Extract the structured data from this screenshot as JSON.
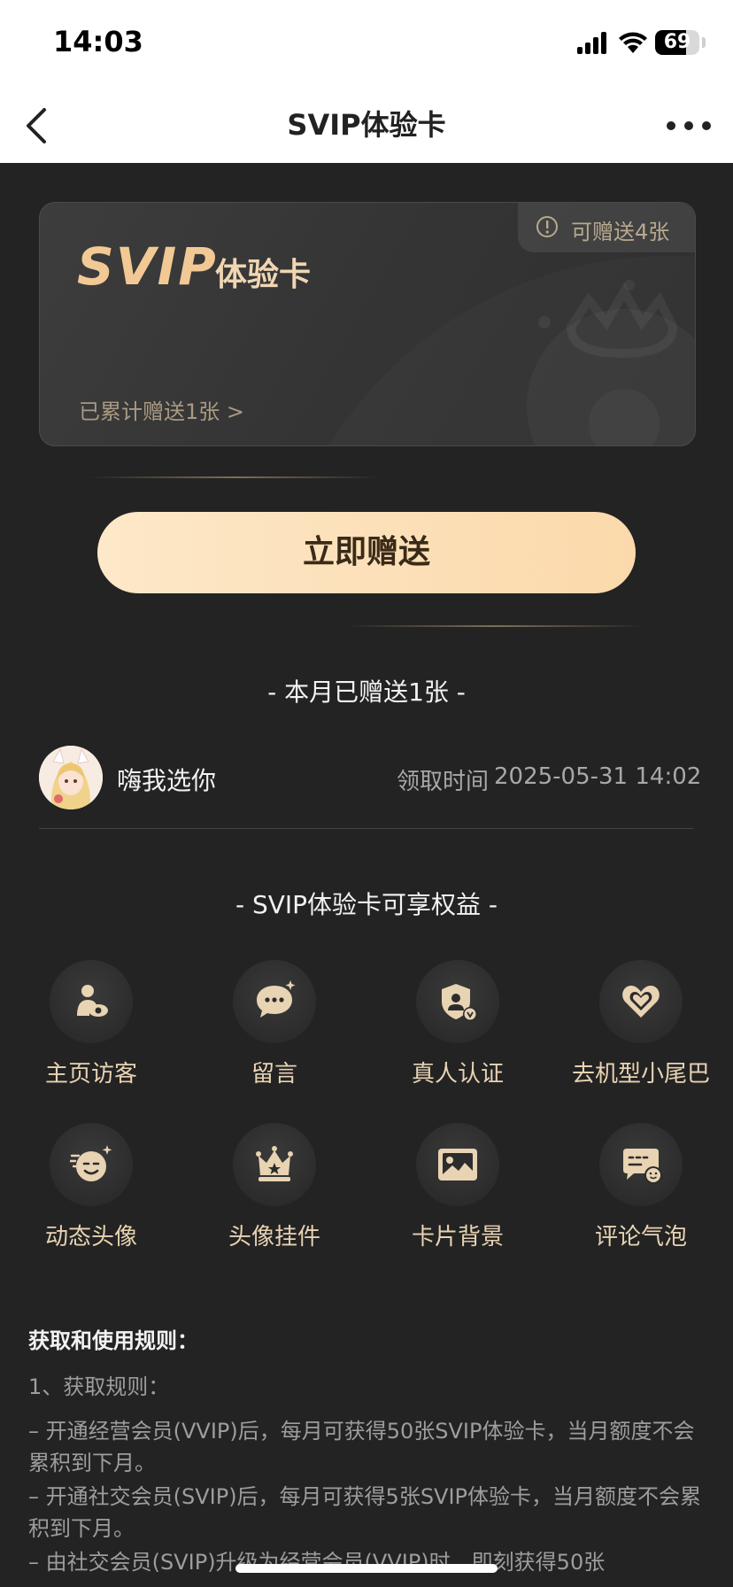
{
  "status": {
    "time": "14:03",
    "battery": "69",
    "battery_level": 0.69
  },
  "nav": {
    "title": "SVIP体验卡"
  },
  "card": {
    "logo": "SVIP",
    "subtitle": "体验卡",
    "badge": "可赠送4张",
    "count": "已累计赠送1张 >"
  },
  "send_button": "立即赠送",
  "sent_section": {
    "title": "- 本月已赠送1张 -"
  },
  "recipient": {
    "name": "嗨我选你",
    "time_label": "领取时间",
    "time_value": "2025-05-31 14:02"
  },
  "benefits_section": {
    "title": "- SVIP体验卡可享权益 -",
    "items": [
      {
        "label": "主页访客",
        "icon": "profile-visitor-icon"
      },
      {
        "label": "留言",
        "icon": "message-bubble-icon"
      },
      {
        "label": "真人认证",
        "icon": "verified-shield-icon"
      },
      {
        "label": "去机型小尾巴",
        "icon": "heart-tag-icon"
      },
      {
        "label": "动态头像",
        "icon": "animated-face-icon"
      },
      {
        "label": "头像挂件",
        "icon": "crown-pendant-icon"
      },
      {
        "label": "卡片背景",
        "icon": "picture-icon"
      },
      {
        "label": "评论气泡",
        "icon": "comment-bubble-icon"
      }
    ]
  },
  "rules": {
    "title": "获取和使用规则：",
    "heading1": "1、获取规则：",
    "lines": [
      "– 开通经营会员(VVIP)后，每月可获得50张SVIP体验卡，当月额度不会累积到下月。",
      "– 开通社交会员(SVIP)后，每月可获得5张SVIP体验卡，当月额度不会累积到下月。",
      "– 由社交会员(SVIP)升级为经营会员(VVIP)时，即刻获得50张"
    ]
  },
  "colors": {
    "accent": "#f2c994",
    "button": "#fde8c8",
    "background": "#232323"
  }
}
